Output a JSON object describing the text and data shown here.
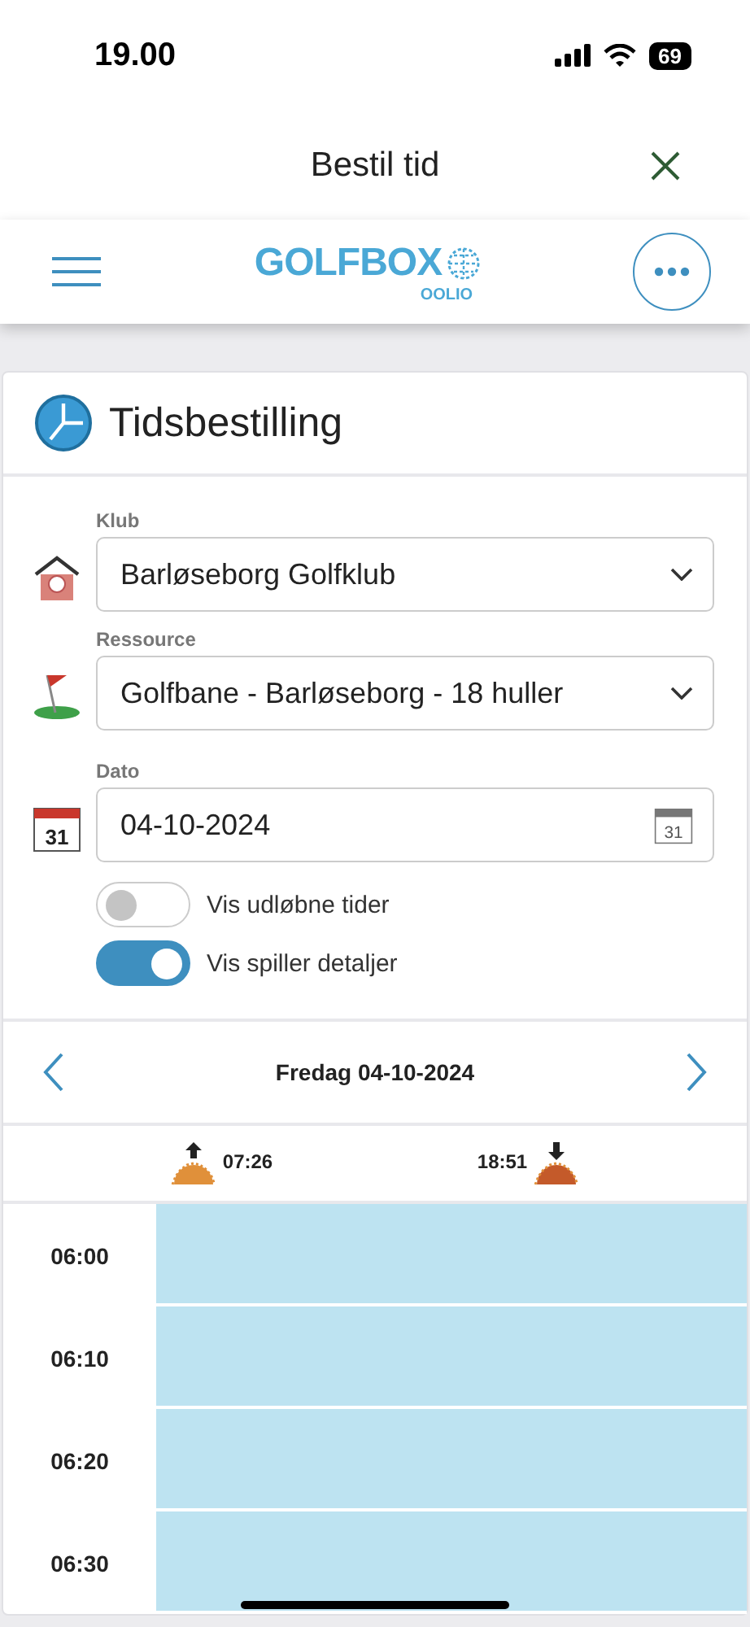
{
  "status_bar": {
    "time": "19.00",
    "battery": "69"
  },
  "header": {
    "title": "Bestil tid"
  },
  "app_bar": {
    "logo": "GOLFBOX",
    "logo_sub": "OOLIO"
  },
  "card": {
    "title": "Tidsbestilling"
  },
  "fields": [
    {
      "kind": "select",
      "label": "Klub",
      "value": "Barløseborg Golfklub"
    },
    {
      "kind": "select",
      "label": "Ressource",
      "value": "Golfbane - Barløseborg - 18 huller"
    },
    {
      "kind": "date",
      "label": "Dato",
      "value": "04-10-2024",
      "icon_day": "31",
      "button_day": "31"
    }
  ],
  "toggles": [
    {
      "label": "Vis udløbne tider",
      "on": false
    },
    {
      "label": "Vis spiller detaljer",
      "on": true
    }
  ],
  "date_nav": {
    "label": "Fredag 04-10-2024"
  },
  "sun": {
    "sunrise": "07:26",
    "sunset": "18:51"
  },
  "slots": [
    {
      "time": "06:00"
    },
    {
      "time": "06:10"
    },
    {
      "time": "06:20"
    },
    {
      "time": "06:30"
    }
  ]
}
